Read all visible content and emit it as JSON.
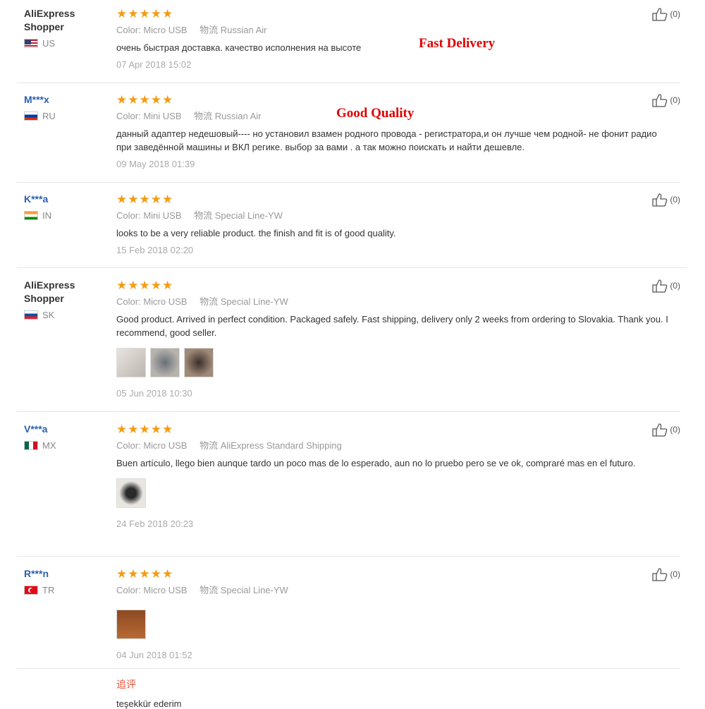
{
  "labels": {
    "color_key": "Color:",
    "shipping_key": "物流",
    "append_title": "追评"
  },
  "overlays": {
    "fast_delivery": "Fast Delivery",
    "good_quality": "Good Quality"
  },
  "reviews": [
    {
      "user": "AliExpress Shopper",
      "country": "US",
      "stars": "★★★★★",
      "color": "Micro USB",
      "shipping": "Russian Air",
      "text": "очень быстрая доставка. качество исполнения на высоте",
      "date": "07 Apr 2018 15:02",
      "likes": "(0)"
    },
    {
      "user": "M***x",
      "country": "RU",
      "stars": "★★★★★",
      "color": "Mini USB",
      "shipping": "Russian Air",
      "text": "данный адаптер недешовый---- но установил взамен родного провода - регистратора,и он лучше чем родной- не фонит радио при заведённой машины и ВКЛ регике. выбор за вами . а так можно поискать и найти дешевле.",
      "date": "09 May 2018 01:39",
      "likes": "(0)"
    },
    {
      "user": "K***a",
      "country": "IN",
      "stars": "★★★★★",
      "color": "Mini USB",
      "shipping": "Special Line-YW",
      "text": "looks to be a very reliable product. the finish and fit is of good quality.",
      "date": "15 Feb 2018 02:20",
      "likes": "(0)"
    },
    {
      "user": "AliExpress Shopper",
      "country": "SK",
      "stars": "★★★★★",
      "color": "Micro USB",
      "shipping": "Special Line-YW",
      "text": "Good product. Arrived in perfect condition. Packaged safely. Fast shipping, delivery only 2 weeks from ordering to Slovakia. Thank you. I recommend, good seller.",
      "date": "05 Jun 2018 10:30",
      "likes": "(0)"
    },
    {
      "user": "V***a",
      "country": "MX",
      "stars": "★★★★★",
      "color": "Micro USB",
      "shipping": "AliExpress Standard Shipping",
      "text": "Buen artículo, llego bien aunque tardo un poco mas de lo esperado, aun no lo pruebo pero se ve ok, compraré mas en el futuro.",
      "date": "24 Feb 2018 20:23",
      "likes": "(0)"
    },
    {
      "user": "R***n",
      "country": "TR",
      "stars": "★★★★★",
      "color": "Micro USB",
      "shipping": "Special Line-YW",
      "text": "",
      "date": "04 Jun 2018 01:52",
      "likes": "(0)",
      "append": "teşekkür ederim"
    }
  ]
}
